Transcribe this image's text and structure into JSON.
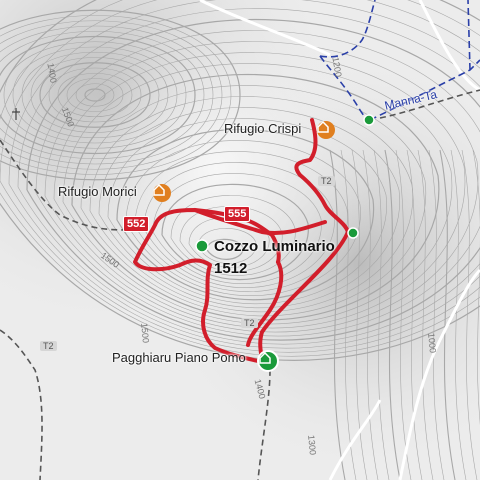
{
  "poi": {
    "rifugio_crispi": "Rifugio Crispi",
    "rifugio_morici": "Rifugio Morici",
    "pagghiaru": "Pagghiaru Piano Pomo"
  },
  "summit": {
    "name": "Cozzo Luminario",
    "elevation": "1512"
  },
  "route_badges": {
    "r552": "552",
    "r555": "555"
  },
  "trail_badges": {
    "t2_west": "T2",
    "t2_east": "T2",
    "t2_south": "T2"
  },
  "roads": {
    "manna": "Manna-Ta"
  },
  "contours": {
    "c1200": "1200",
    "c1400": "1400",
    "c1500_west": "1500",
    "c1500_south": "1500",
    "c1500_mid": "1500",
    "c1400_south": "1400",
    "c1000": "1000",
    "c1300": "1300"
  },
  "colors": {
    "route": "#d21e2b",
    "road": "#2a3fa8",
    "hut_icon": "#e07f1f",
    "shelter_icon": "#1a9a3a",
    "map_background": "#ececec"
  }
}
